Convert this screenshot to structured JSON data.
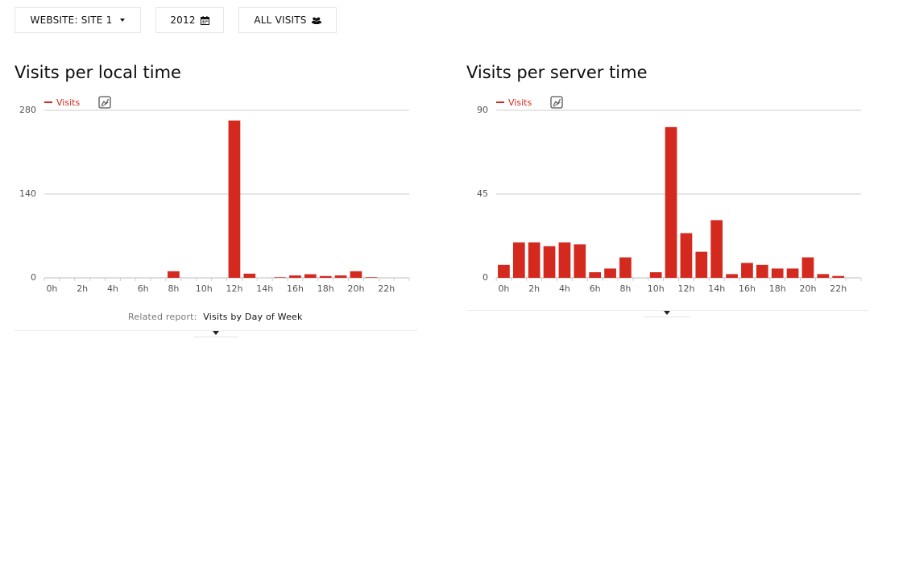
{
  "toolbar": {
    "site_label": "WEBSITE: SITE 1",
    "period_label": "2012",
    "segment_label": "ALL VISITS",
    "site_icon": "caret-down-icon",
    "period_icon": "calendar-icon",
    "segment_icon": "users-icon"
  },
  "accent_color": "#d4291f",
  "widgets": [
    {
      "title": "Visits per local time",
      "legend_label": "Visits",
      "evolution_icon": "evolution-graph-icon",
      "related_prefix": "Related report:",
      "related_link": "Visits by Day of Week"
    },
    {
      "title": "Visits per server time",
      "legend_label": "Visits",
      "evolution_icon": "evolution-graph-icon"
    }
  ],
  "chart_data": [
    {
      "type": "bar",
      "x_tick_labels": [
        "0h",
        "2h",
        "4h",
        "6h",
        "8h",
        "10h",
        "12h",
        "14h",
        "16h",
        "18h",
        "20h",
        "22h"
      ],
      "categories": [
        "0h",
        "1h",
        "2h",
        "3h",
        "4h",
        "5h",
        "6h",
        "7h",
        "8h",
        "9h",
        "10h",
        "11h",
        "12h",
        "13h",
        "14h",
        "15h",
        "16h",
        "17h",
        "18h",
        "19h",
        "20h",
        "21h",
        "22h",
        "23h"
      ],
      "series": [
        {
          "name": "Visits",
          "values": [
            0,
            0,
            0,
            0,
            0,
            0,
            0,
            0,
            11,
            0,
            0,
            0,
            263,
            7,
            0,
            1,
            4,
            6,
            3,
            4,
            11,
            1,
            0,
            0
          ]
        }
      ],
      "yticks": [
        0,
        140,
        280
      ],
      "ylim": [
        0,
        280
      ],
      "grid": true,
      "legend": "top-left"
    },
    {
      "type": "bar",
      "x_tick_labels": [
        "0h",
        "2h",
        "4h",
        "6h",
        "8h",
        "10h",
        "12h",
        "14h",
        "16h",
        "18h",
        "20h",
        "22h"
      ],
      "categories": [
        "0h",
        "1h",
        "2h",
        "3h",
        "4h",
        "5h",
        "6h",
        "7h",
        "8h",
        "9h",
        "10h",
        "11h",
        "12h",
        "13h",
        "14h",
        "15h",
        "16h",
        "17h",
        "18h",
        "19h",
        "20h",
        "21h",
        "22h",
        "23h"
      ],
      "series": [
        {
          "name": "Visits",
          "values": [
            7,
            19,
            19,
            17,
            19,
            18,
            3,
            5,
            11,
            0,
            3,
            81,
            24,
            14,
            31,
            2,
            8,
            7,
            5,
            5,
            11,
            2,
            1,
            0
          ]
        }
      ],
      "yticks": [
        0,
        45,
        90
      ],
      "ylim": [
        0,
        90
      ],
      "grid": true,
      "legend": "top-left"
    }
  ]
}
